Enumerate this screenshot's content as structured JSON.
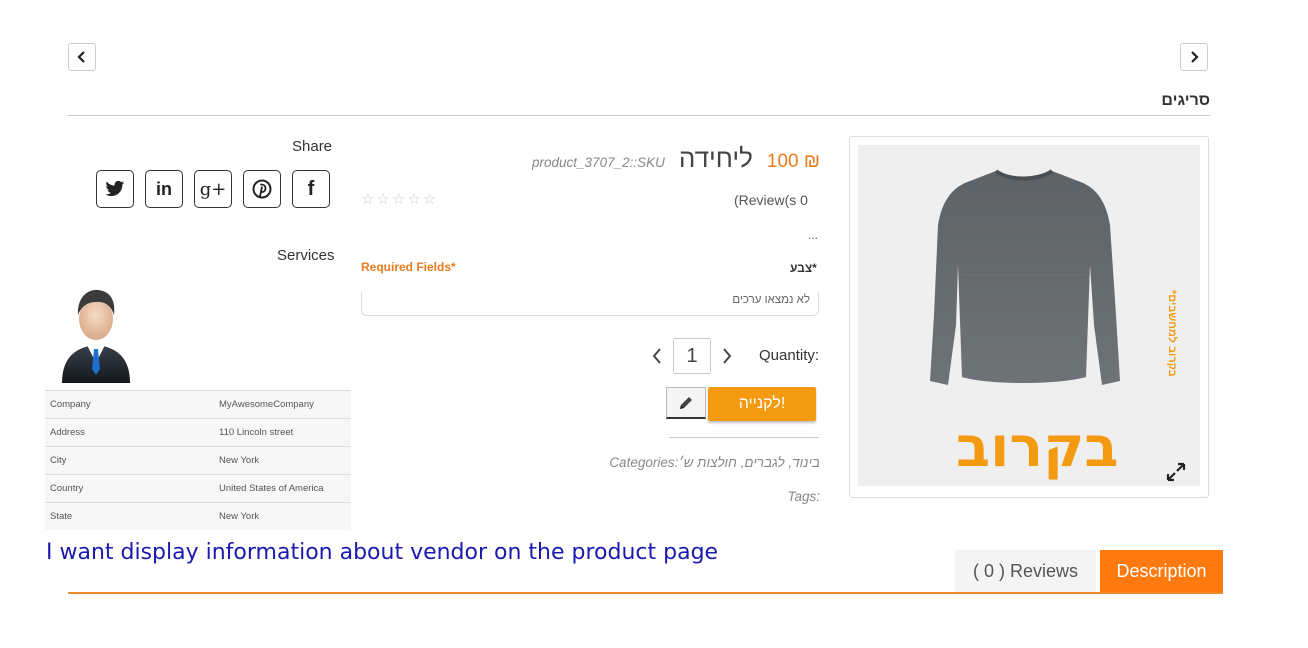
{
  "header": {
    "category_title": "סריגים"
  },
  "share": {
    "title": "Share",
    "icons": [
      "twitter-icon",
      "linkedin-icon",
      "google-plus-icon",
      "pinterest-icon",
      "facebook-icon"
    ],
    "glyphs": {
      "twitter": "🐦",
      "linkedin": "in",
      "google_plus": "g+",
      "pinterest": "P",
      "facebook": "f"
    }
  },
  "services": {
    "title": "Services"
  },
  "vendor": {
    "rows": [
      {
        "label": "Company",
        "value": "MyAwesomeCompany"
      },
      {
        "label": "Address",
        "value": "110 Lincoln street"
      },
      {
        "label": "City",
        "value": "New York"
      },
      {
        "label": "Country",
        "value": "United States of America"
      },
      {
        "label": "State",
        "value": "New York"
      }
    ]
  },
  "product": {
    "price": "100 ₪",
    "title": "ליחידה",
    "sku": "product_3707_2::SKU",
    "reviews_text": "(Review(s 0",
    "ellipsis": "...",
    "color_label": "צבע*",
    "required_fields": "Required Fields*",
    "color_select_value": "לא נמצאו ערכים",
    "quantity_label": "Quantity:",
    "quantity_value": "1",
    "buy_label": "לקנייה!",
    "categories": "Categories:בינוד, לגברים, חולצות ש׳",
    "tags": "Tags:",
    "image_caption": "בקרוב",
    "image_side_text": "*בקרוב למחשבים"
  },
  "annotation": {
    "text": "I want display information about vendor on the product page"
  },
  "tabs": [
    {
      "label": "( 0 ) Reviews",
      "active": false
    },
    {
      "label": "Description",
      "active": true
    }
  ],
  "colors": {
    "accent": "#f39a10",
    "tab_active": "#ff7a0e",
    "underline": "#f08a2a",
    "annotation": "#1a1ab0"
  }
}
